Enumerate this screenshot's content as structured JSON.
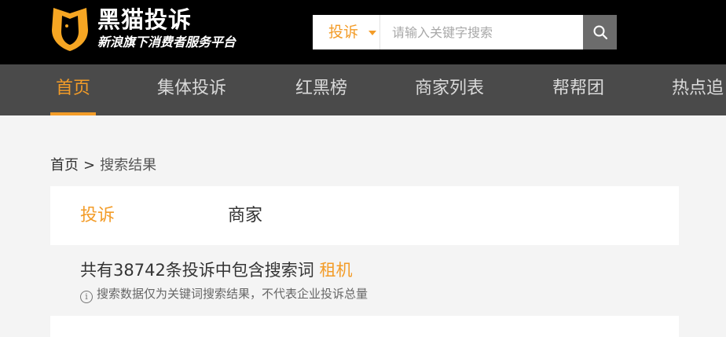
{
  "header": {
    "brand_name": "黑猫投诉",
    "brand_slogan": "新浪旗下消费者服务平台",
    "logo_icon": "cat-shield-icon"
  },
  "search": {
    "type_label": "投诉",
    "placeholder": "请输入关键字搜索",
    "value": "",
    "button_icon": "search-icon"
  },
  "nav": {
    "items": [
      {
        "label": "首页",
        "active": true
      },
      {
        "label": "集体投诉"
      },
      {
        "label": "红黑榜"
      },
      {
        "label": "商家列表"
      },
      {
        "label": "帮帮团"
      },
      {
        "label": "热点追"
      }
    ]
  },
  "breadcrumb": {
    "home": "首页",
    "separator": ">",
    "current": "搜索结果"
  },
  "tabs": [
    {
      "label": "投诉",
      "active": true
    },
    {
      "label": "商家",
      "active": false
    }
  ],
  "result": {
    "prefix": "共有38742条投诉中包含搜索词",
    "keyword": "租机",
    "note": "搜索数据仅为关键词搜索结果，不代表企业投诉总量",
    "info_icon": "info-icon"
  },
  "colors": {
    "accent": "#f39c28",
    "header_bg": "#000000",
    "nav_bg": "#4a4a4a",
    "page_bg": "#f4f4f4"
  }
}
